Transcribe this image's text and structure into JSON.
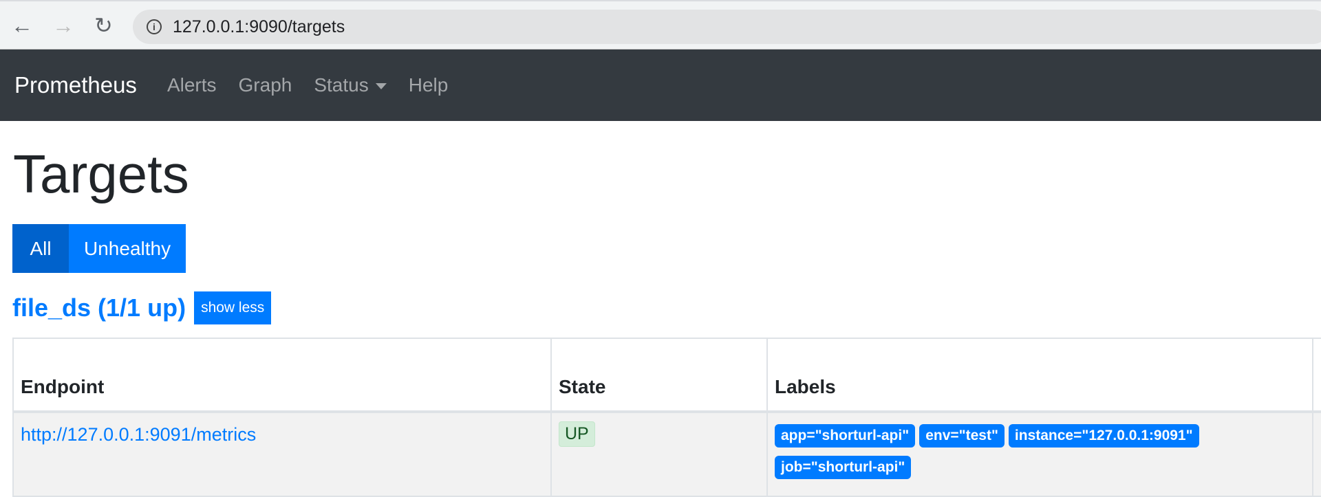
{
  "browser": {
    "url": "127.0.0.1:9090/targets"
  },
  "navbar": {
    "brand": "Prometheus",
    "items": [
      {
        "label": "Alerts"
      },
      {
        "label": "Graph"
      },
      {
        "label": "Status"
      },
      {
        "label": "Help"
      }
    ]
  },
  "page": {
    "title": "Targets",
    "filters": {
      "all": "All",
      "unhealthy": "Unhealthy"
    }
  },
  "pool": {
    "title": "file_ds (1/1 up)",
    "toggle": "show less",
    "columns": [
      "Endpoint",
      "State",
      "Labels"
    ],
    "rows": [
      {
        "endpoint": "http://127.0.0.1:9091/metrics",
        "state": "UP",
        "labels": [
          "app=\"shorturl-api\"",
          "env=\"test\"",
          "instance=\"127.0.0.1:9091\"",
          "job=\"shorturl-api\""
        ]
      }
    ]
  },
  "colors": {
    "primary": "#007bff",
    "navbar": "#343a40",
    "up_badge": "#d4edda"
  }
}
